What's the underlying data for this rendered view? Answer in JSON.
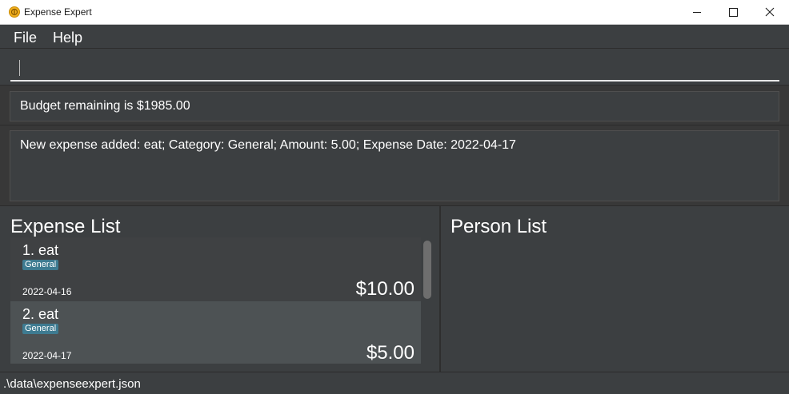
{
  "window": {
    "title": "Expense Expert",
    "icon": "app-coin-icon"
  },
  "controls": {
    "minimize_icon": "minimize-icon",
    "maximize_icon": "maximize-icon",
    "close_icon": "close-icon"
  },
  "menu": {
    "items": [
      "File",
      "Help"
    ]
  },
  "command": {
    "value": "",
    "placeholder": ""
  },
  "budget": {
    "text": "Budget remaining is $1985.00"
  },
  "result": {
    "text": "New expense added: eat; Category: General; Amount: 5.00; Expense Date: 2022-04-17"
  },
  "expense_list": {
    "title": "Expense List",
    "items": [
      {
        "index": "1.  eat",
        "category": "General",
        "date": "2022-04-16",
        "amount": "$10.00"
      },
      {
        "index": "2.  eat",
        "category": "General",
        "date": "2022-04-17",
        "amount": "$5.00"
      }
    ]
  },
  "person_list": {
    "title": "Person List"
  },
  "status": {
    "path": ".\\data\\expenseexpert.json"
  },
  "colors": {
    "background": "#3c3f41",
    "selected_card": "#4d5254",
    "tag": "#3e7b91"
  }
}
